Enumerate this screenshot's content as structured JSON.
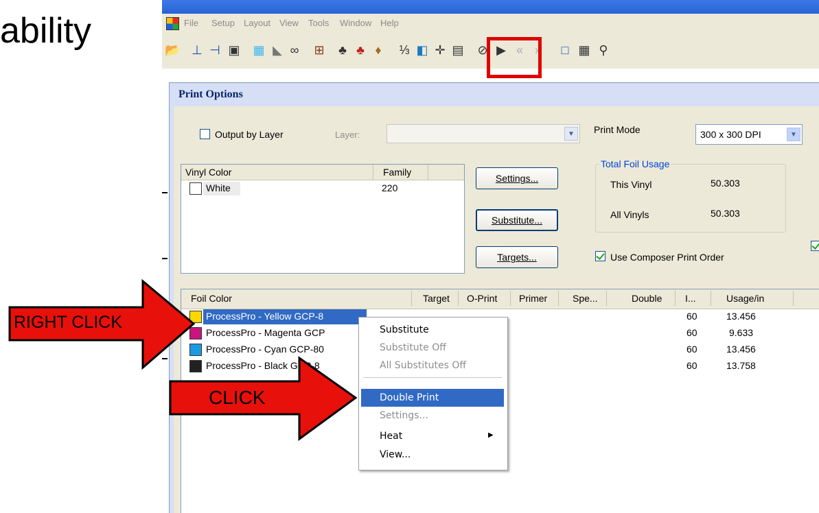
{
  "slide": {
    "title_fragment": "ability"
  },
  "app": {
    "menu": [
      "File",
      "Setup",
      "Layout",
      "View",
      "Tools",
      "Window",
      "Help"
    ]
  },
  "toolbar_icons": [
    "open-folder-icon",
    "align-left-icon",
    "align-h-icon",
    "align-e-icon",
    "grid-icon",
    "fill-icon",
    "link-icon",
    "pin-icon",
    "person-a-icon",
    "person-b-icon",
    "person-c-icon",
    "numbering-icon",
    "export-icon",
    "move-icon",
    "frame-icon",
    "erase-icon",
    "pointer-icon",
    "rewind-icon",
    "fast-forward-icon",
    "select-rect-icon",
    "table-icon",
    "zoom-icon"
  ],
  "dialog": {
    "title": "Print Options",
    "output_by_layer": {
      "label": "Output by Layer",
      "checked": false
    },
    "layer": {
      "label": "Layer:",
      "value": ""
    },
    "print_mode": {
      "label": "Print Mode",
      "value": "300 x 300 DPI"
    },
    "vinyl_list": {
      "columns": [
        "Vinyl Color",
        "Family"
      ],
      "rows": [
        {
          "color": "White",
          "family": "220",
          "swatch": "#ffffff"
        }
      ]
    },
    "buttons": {
      "settings": "Settings...",
      "substitute": "Substitute...",
      "targets": "Targets..."
    },
    "total_foil_usage": {
      "title": "Total Foil Usage",
      "this_vinyl_label": "This Vinyl",
      "this_vinyl_value": "50.303",
      "all_vinyls_label": "All Vinyls",
      "all_vinyls_value": "50.303"
    },
    "use_composer_print_order": {
      "label": "Use Composer Print Order",
      "checked": true
    },
    "foil_list": {
      "columns": [
        "Foil Color",
        "Target",
        "O-Print",
        "Primer",
        "Spe...",
        "Double",
        "I...",
        "Usage/in"
      ],
      "rows": [
        {
          "name": "ProcessPro - Yellow GCP-8",
          "swatch": "#ffd800",
          "i": "60",
          "usage": "13.456",
          "selected": true
        },
        {
          "name": "ProcessPro - Magenta GCP",
          "swatch": "#c8147c",
          "i": "60",
          "usage": "9.633",
          "selected": false
        },
        {
          "name": "ProcessPro - Cyan GCP-80",
          "swatch": "#1a9be0",
          "i": "60",
          "usage": "13.456",
          "selected": false
        },
        {
          "name": "ProcessPro - Black GCP-8",
          "swatch": "#222222",
          "i": "60",
          "usage": "13.758",
          "selected": false
        }
      ]
    }
  },
  "context_menu": {
    "items": [
      {
        "label": "Substitute",
        "enabled": true
      },
      {
        "label": "Substitute Off",
        "enabled": false
      },
      {
        "label": "All Substitutes Off",
        "enabled": false
      },
      {
        "label": "Double Print",
        "enabled": true,
        "highlighted": true
      },
      {
        "label": "Settings...",
        "enabled": false
      },
      {
        "label": "Heat",
        "enabled": true,
        "submenu": true
      },
      {
        "label": "View...",
        "enabled": true
      }
    ]
  },
  "annotations": {
    "right_click_label": "RIGHT CLICK",
    "click_label": "CLICK",
    "arrow_color": "#e8100b",
    "highlight_color": "#e00000"
  }
}
